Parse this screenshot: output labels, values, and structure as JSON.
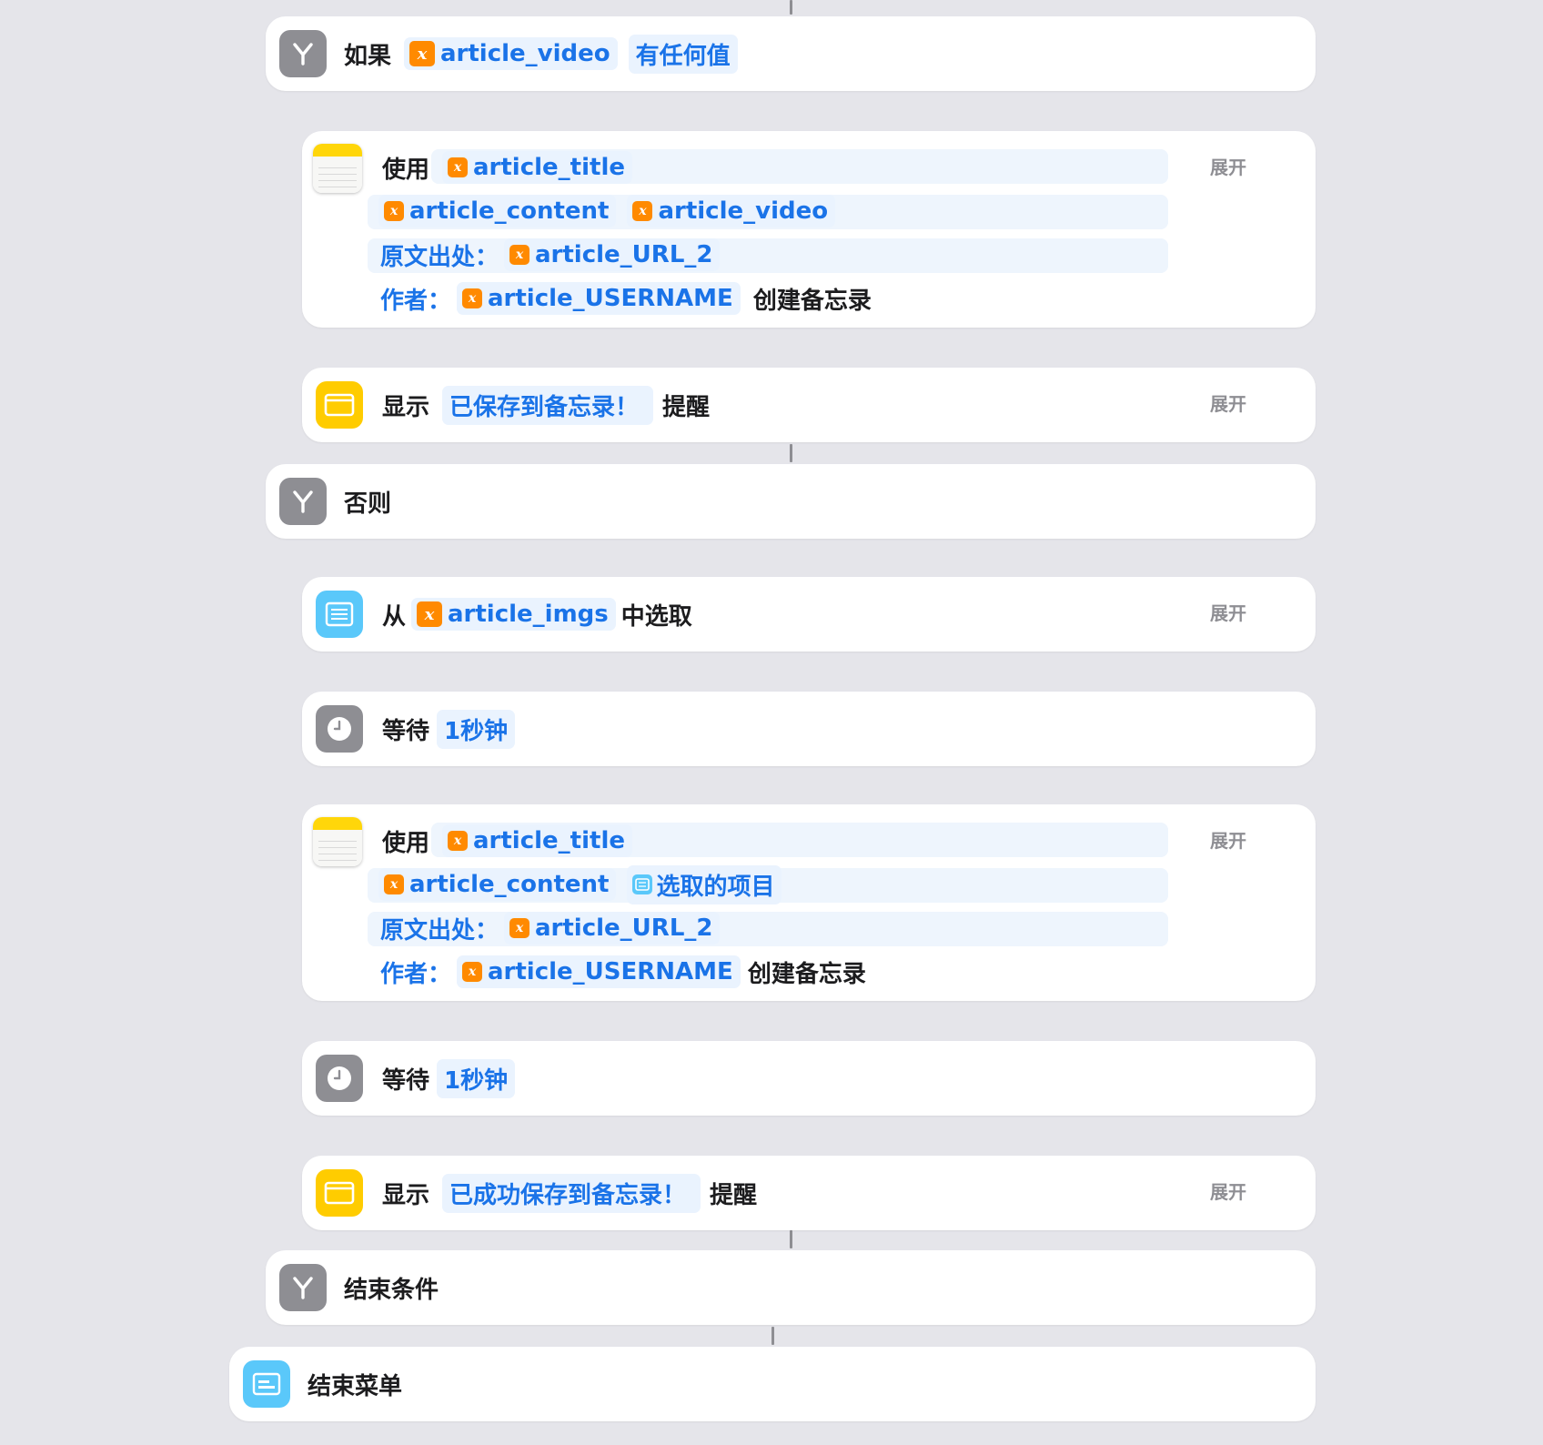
{
  "if_block": {
    "keyword": "如果",
    "variable": "article_video",
    "condition": "有任何值"
  },
  "note1": {
    "verb": "使用",
    "title_var": "article_title",
    "content_var": "article_content",
    "video_var": "article_video",
    "source_label": "原文出处：",
    "url_var": "article_URL_2",
    "author_label": "作者：",
    "username_var": "article_USERNAME",
    "action": "创建备忘录",
    "expand": "展开"
  },
  "alert1": {
    "verb": "显示",
    "message": "已保存到备忘录！",
    "action": "提醒",
    "expand": "展开"
  },
  "otherwise": {
    "label": "否则"
  },
  "choose": {
    "from": "从",
    "variable": "article_imgs",
    "action": "中选取",
    "expand": "展开"
  },
  "wait1": {
    "verb": "等待",
    "duration": "1秒钟"
  },
  "note2": {
    "verb": "使用",
    "title_var": "article_title",
    "content_var": "article_content",
    "selected_item": "选取的项目",
    "source_label": "原文出处：",
    "url_var": "article_URL_2",
    "author_label": "作者：",
    "username_var": "article_USERNAME",
    "action": "创建备忘录",
    "expand": "展开"
  },
  "wait2": {
    "verb": "等待",
    "duration": "1秒钟"
  },
  "alert2": {
    "verb": "显示",
    "message": "已成功保存到备忘录！",
    "action": "提醒",
    "expand": "展开"
  },
  "end_if": {
    "label": "结束条件"
  },
  "end_menu": {
    "label": "结束菜单"
  },
  "icons": {
    "if": "branch-icon",
    "notes": "notes-icon",
    "alert": "alert-window-icon",
    "list": "list-icon",
    "wait": "clock-icon",
    "menu": "menu-icon",
    "variable": "variable-x-icon"
  },
  "colors": {
    "background": "#e5e5ea",
    "token_blue": "#1a73e8",
    "variable_orange": "#ff8a00",
    "alert_yellow": "#ffcc00",
    "list_blue": "#5ac8fa",
    "control_gray": "#8e8e93"
  }
}
